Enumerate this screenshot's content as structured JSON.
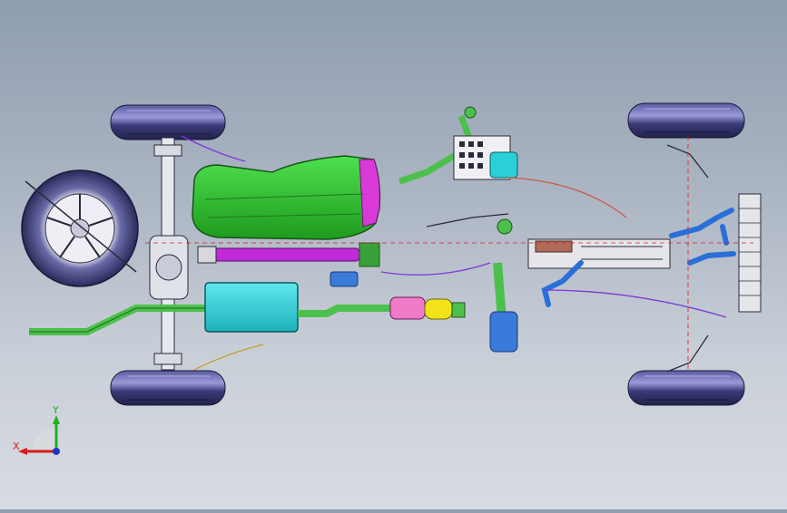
{
  "viewport": {
    "background_top": "#8f9db0",
    "background_bottom": "#d8dce2"
  },
  "triad": {
    "x_label": "X",
    "y_label": "Y",
    "x_color": "#d81b1b",
    "y_color": "#1fb01f",
    "z_color": "#2233cc"
  },
  "colors": {
    "tire": "#34346a",
    "tire_highlight": "#8a8ad0",
    "fuel_tank": "#2ec82e",
    "driveshaft": "#c02ad8",
    "muffler": "#2ad0d8",
    "catalytic_converter": "#f07cc8",
    "flange": "#f2e21a",
    "exhaust_pipe": "#4cc04c",
    "coolant_hose": "#2a6fd8",
    "radiator": "#e4e6ea"
  }
}
